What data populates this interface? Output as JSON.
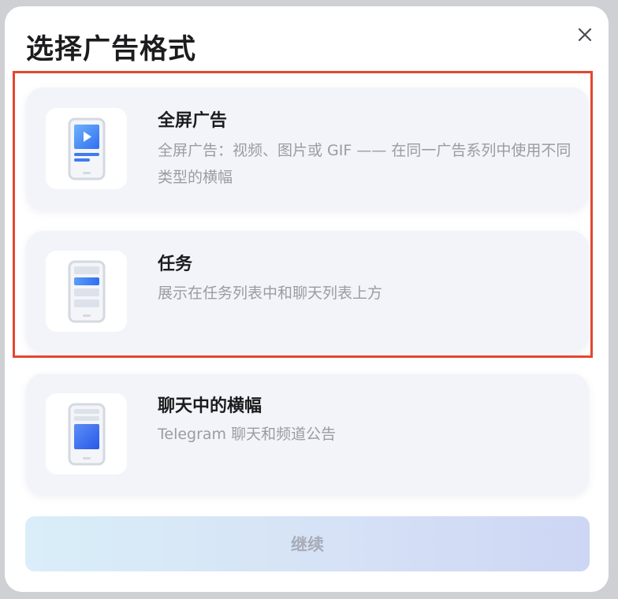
{
  "dialog": {
    "title": "选择广告格式",
    "close_icon": "close-icon"
  },
  "formats": [
    {
      "title": "全屏广告",
      "description": "全屏广告：视频、图片或 GIF —— 在同一广告系列中使用不同类型的横幅",
      "icon": "phone-fullscreen-video-icon"
    },
    {
      "title": "任务",
      "description": "展示在任务列表中和聊天列表上方",
      "icon": "phone-task-list-icon"
    },
    {
      "title": "聊天中的横幅",
      "description": "Telegram 聊天和频道公告",
      "icon": "phone-chat-banner-icon"
    }
  ],
  "continue_label": "继续",
  "colors": {
    "accent_blue": "#2f6ff0",
    "highlight_border": "#e2472f",
    "card_bg": "#f2f4f9"
  }
}
